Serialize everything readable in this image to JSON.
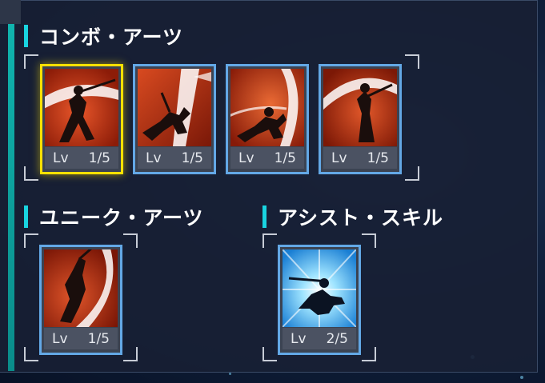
{
  "combo_arts": {
    "title": "コンボ・アーツ",
    "cards": [
      {
        "icon": "sword-slash-skill-icon",
        "level_label": "Lv",
        "level_value": "1/5",
        "selected": true
      },
      {
        "icon": "dash-strike-skill-icon",
        "level_label": "Lv",
        "level_value": "1/5",
        "selected": false
      },
      {
        "icon": "lunge-thrust-skill-icon",
        "level_label": "Lv",
        "level_value": "1/5",
        "selected": false
      },
      {
        "icon": "spin-slash-skill-icon",
        "level_label": "Lv",
        "level_value": "1/5",
        "selected": false
      }
    ]
  },
  "unique_arts": {
    "title": "ユニーク・アーツ",
    "cards": [
      {
        "icon": "aerial-dive-skill-icon",
        "level_label": "Lv",
        "level_value": "1/5"
      }
    ]
  },
  "assist_skill": {
    "title": "アシスト・スキル",
    "cards": [
      {
        "icon": "burst-charge-skill-icon",
        "level_label": "Lv",
        "level_value": "2/5"
      }
    ]
  },
  "colors": {
    "accent_cyan": "#19d4e0",
    "selected_yellow": "#ffe100",
    "card_border_blue": "#63a8e6",
    "skill_red": "#c13a12",
    "assist_blue": "#2fa3e8"
  }
}
